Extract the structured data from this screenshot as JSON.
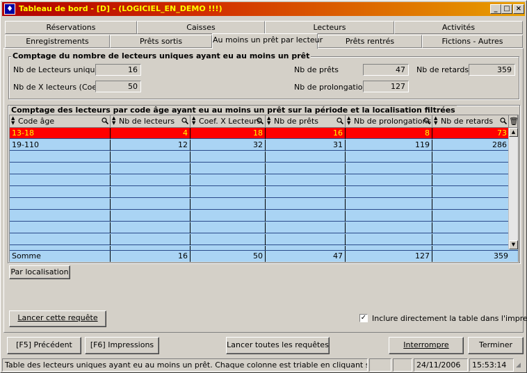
{
  "window": {
    "title": "Tableau de bord  - [D] - (LOGICIEL_EN_DEMO !!!)",
    "min_label": "_",
    "max_label": "□",
    "close_label": "×"
  },
  "tabs_row1": [
    "Réservations",
    "Caisses",
    "Lecteurs",
    "Activités"
  ],
  "tabs_row2": [
    "Enregistrements",
    "Prêts sortis",
    "Au moins un prêt par lecteur",
    "Prêts rentrés",
    "Fictions - Autres"
  ],
  "summary": {
    "title": "Comptage du nombre de lecteurs uniques ayant eu au moins un prêt",
    "nb_lecteurs_label": "Nb de Lecteurs uniques",
    "nb_lecteurs_value": "16",
    "nb_x_label": "Nb de X lecteurs (Coef.)",
    "nb_x_value": "50",
    "nb_prets_label": "Nb de prêts",
    "nb_prets_value": "47",
    "nb_prolong_label": "Nb de prolongations",
    "nb_prolong_value": "127",
    "nb_retards_label": "Nb de retards",
    "nb_retards_value": "359"
  },
  "table": {
    "title": "Comptage des lecteurs par code âge ayant eu au moins un prêt sur la période et la localisation filtrées",
    "columns": [
      "Code âge",
      "Nb de lecteurs",
      "Coef. X Lecteurs",
      "Nb de prêts",
      "Nb de prolongations",
      "Nb de retards"
    ],
    "rows": [
      [
        "13-18",
        "4",
        "18",
        "16",
        "8",
        "73"
      ],
      [
        "19-110",
        "12",
        "32",
        "31",
        "119",
        "286"
      ]
    ],
    "sum": [
      "Somme",
      "16",
      "50",
      "47",
      "127",
      "359"
    ]
  },
  "buttons": {
    "par_localisation": "Par localisation",
    "lancer_requete": "Lancer cette requête",
    "inclure_label": "Inclure directement la table dans l'impression",
    "precedent": "[F5] Précédent",
    "impressions": "[F6] Impressions",
    "lancer_toutes": "Lancer toutes les requêtes",
    "interrompre": "Interrompre",
    "terminer": "Terminer"
  },
  "statusbar": {
    "message": "Table des lecteurs uniques ayant eu au moins un prêt. Chaque colonne est triable en cliquant sur son titre",
    "date": "24/11/2006",
    "time": "15:53:14"
  },
  "colors": {
    "selected_row": "#ff0000",
    "selected_text": "#ffff00",
    "grid_bg": "#aad4f4"
  }
}
